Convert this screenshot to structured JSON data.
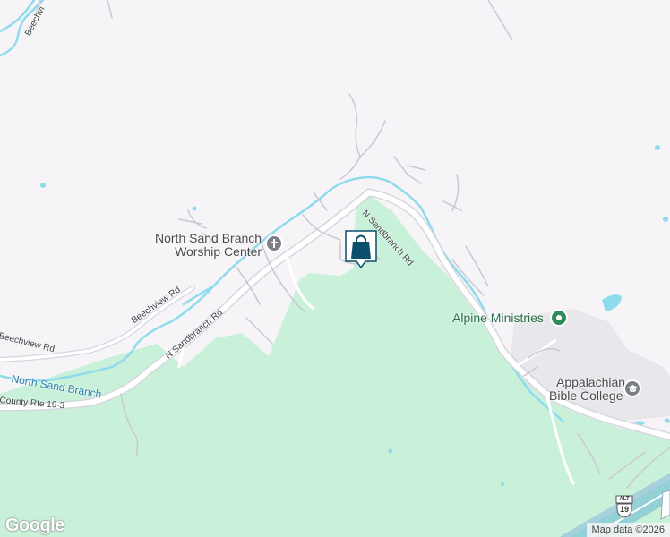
{
  "map": {
    "roads": {
      "n_sandbranch_rd_upper": "N Sandbranch Rd",
      "n_sandbranch_rd_lower": "N Sandbranch Rd",
      "beechview_rd_mid": "Beechview Rd",
      "beechview_rd_left": "Beechview Rd",
      "beechview_top": "Beechvi",
      "county_rte": "County Rte 19-3"
    },
    "water": {
      "north_sand_branch": "North Sand Branch"
    },
    "pois": {
      "worship_center_line1": "North Sand Branch",
      "worship_center_line2": "Worship Center",
      "alpine_ministries": "Alpine Ministries",
      "appalachian_line1": "Appalachian",
      "appalachian_line2": "Bible College"
    },
    "shields": {
      "alt_label": "ALT",
      "route_number": "19"
    },
    "branding": {
      "logo": "Google",
      "attribution": "Map data ©2026"
    },
    "colors": {
      "background": "#f6f4f7",
      "park": "#c9f1d9",
      "water": "#8fdbee",
      "road": "#ffffff",
      "road_casing": "#d6d6de",
      "marker": "#0a4f6b"
    },
    "icons": {
      "worship_center": "church-cross-icon",
      "alpine_ministries": "place-pin-icon",
      "appalachian": "graduation-cap-icon",
      "marker": "shopping-bag-icon"
    }
  }
}
